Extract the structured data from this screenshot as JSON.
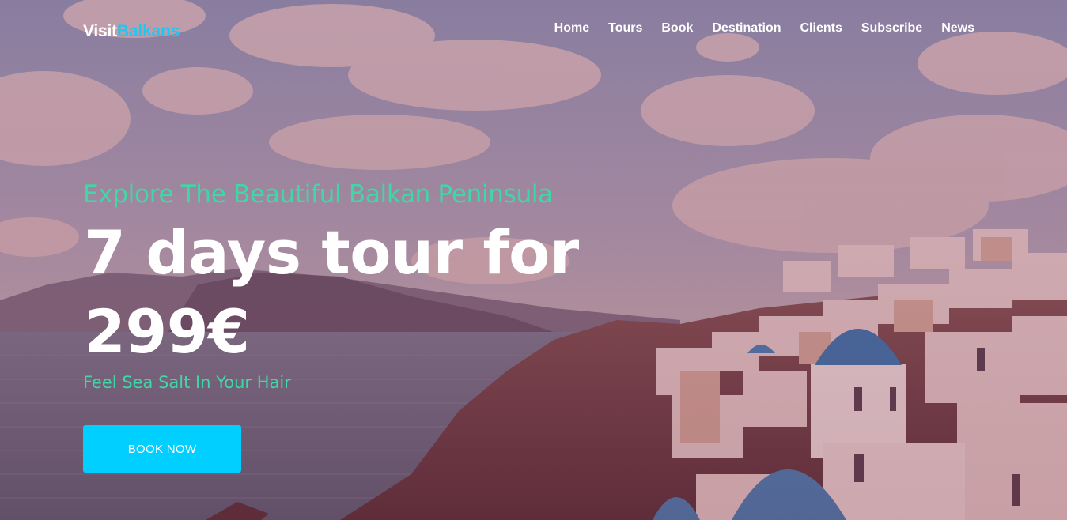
{
  "header": {
    "logo_part1": "Visit",
    "logo_part2": "Balkans",
    "nav": [
      "Home",
      "Tours",
      "Book",
      "Destination",
      "Clients",
      "Subscribe",
      "News"
    ]
  },
  "hero": {
    "tagline": "Explore The Beautiful Balkan Peninsula",
    "headline": "7 days tour for 299€",
    "subline": "Feel Sea Salt In Your Hair",
    "cta_label": "BOOK NOW"
  },
  "colors": {
    "accent": "#1fc8f2",
    "button": "#00cfff",
    "highlight_text": "#3fd7a6"
  }
}
